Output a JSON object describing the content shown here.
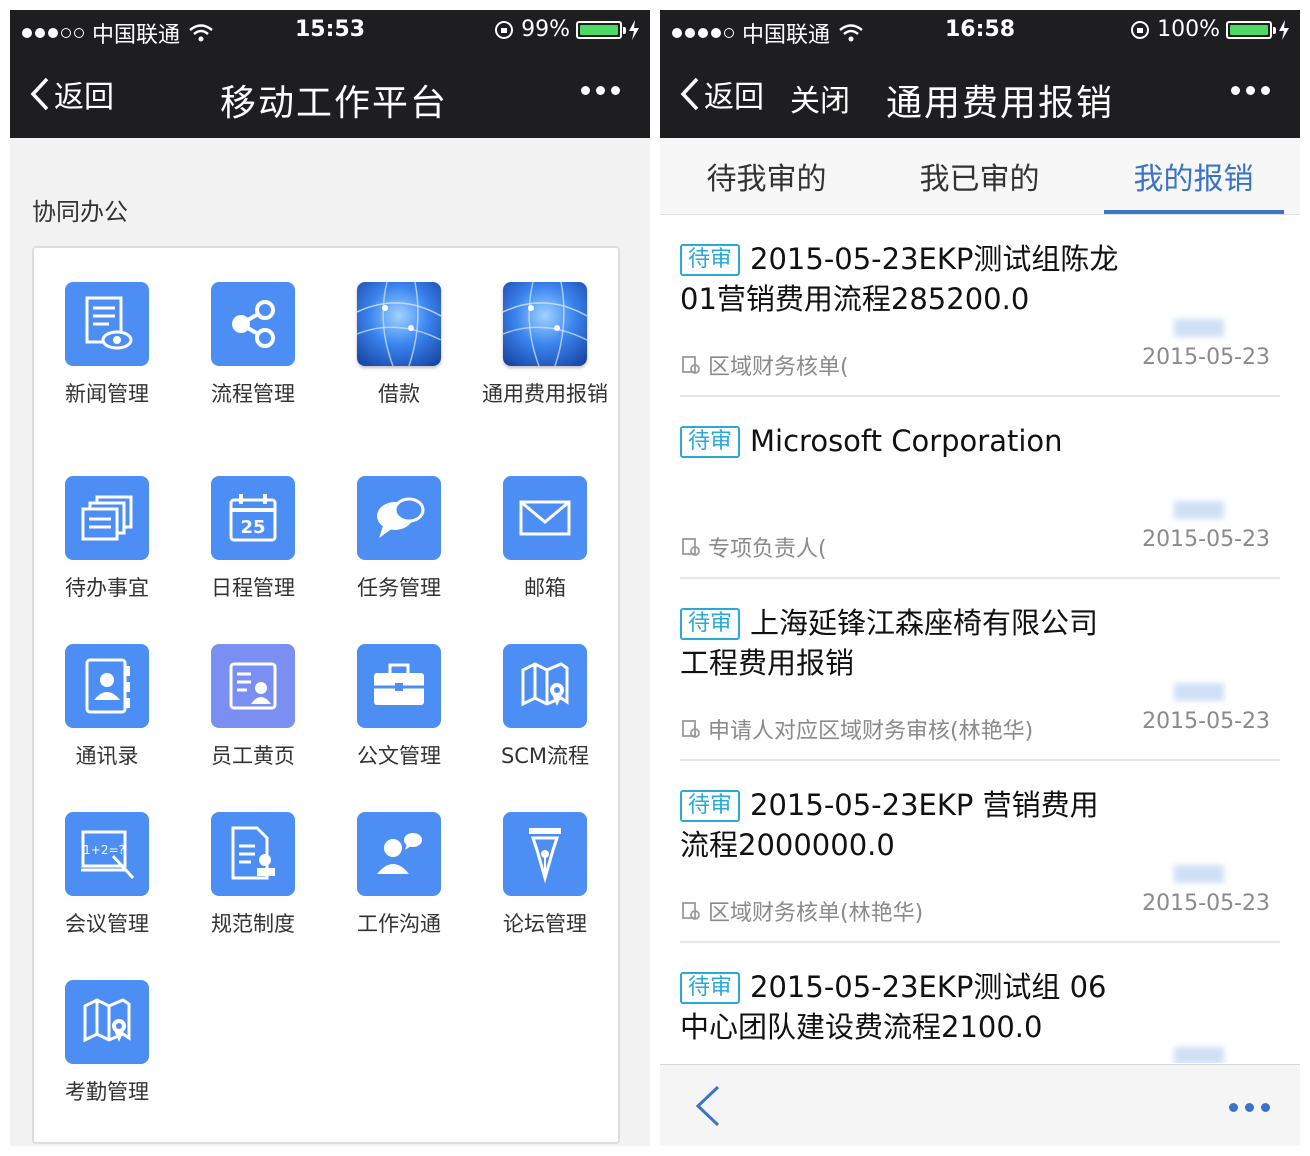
{
  "left": {
    "status": {
      "carrier": "中国联通",
      "time": "15:53",
      "battery": "99%",
      "battery_level": 0.99
    },
    "nav": {
      "back": "返回",
      "title": "移动工作平台"
    },
    "section_title": "协同办公",
    "apps": [
      {
        "label": "新闻管理",
        "icon": "news-icon"
      },
      {
        "label": "流程管理",
        "icon": "share-flow-icon"
      },
      {
        "label": "借款",
        "icon": "globe-icon"
      },
      {
        "label": "通用费用报销",
        "icon": "globe-icon"
      },
      {
        "label": "待办事宜",
        "icon": "todo-list-icon"
      },
      {
        "label": "日程管理",
        "icon": "calendar-icon",
        "icon_text": "25"
      },
      {
        "label": "任务管理",
        "icon": "chat-bubbles-icon"
      },
      {
        "label": "邮箱",
        "icon": "mail-icon"
      },
      {
        "label": "通讯录",
        "icon": "contacts-icon"
      },
      {
        "label": "员工黄页",
        "icon": "directory-icon"
      },
      {
        "label": "公文管理",
        "icon": "briefcase-icon"
      },
      {
        "label": "SCM流程",
        "icon": "map-pin-icon"
      },
      {
        "label": "会议管理",
        "icon": "whiteboard-icon",
        "icon_text": "1+2=?"
      },
      {
        "label": "规范制度",
        "icon": "document-stamp-icon"
      },
      {
        "label": "工作沟通",
        "icon": "person-talk-icon"
      },
      {
        "label": "论坛管理",
        "icon": "pen-nib-icon"
      },
      {
        "label": "考勤管理",
        "icon": "map-pin-icon"
      }
    ]
  },
  "right": {
    "status": {
      "carrier": "中国联通",
      "time": "16:58",
      "battery": "100%",
      "battery_level": 1.0
    },
    "nav": {
      "back": "返回",
      "close": "关闭",
      "title": "通用费用报销"
    },
    "tabs": [
      {
        "label": "待我审的"
      },
      {
        "label": "我已审的"
      },
      {
        "label": "我的报销",
        "active": true
      }
    ],
    "items": [
      {
        "badge": "待审",
        "title": "2015-05-23EKP测试组陈龙01营销费用流程285200.0",
        "sub": "区域财务核单(",
        "date": "2015-05-23"
      },
      {
        "badge": "待审",
        "title": "Microsoft Corporation",
        "sub": "专项负责人(",
        "date": "2015-05-23"
      },
      {
        "badge": "待审",
        "title": "上海延锋江森座椅有限公司工程费用报销",
        "sub": "申请人对应区域财务审核(林艳华)",
        "date": "2015-05-23"
      },
      {
        "badge": "待审",
        "title": "2015-05-23EKP 营销费用流程2000000.0",
        "sub": "区域财务核单(林艳华)",
        "date": "2015-05-23"
      },
      {
        "badge": "待审",
        "title": "2015-05-23EKP测试组 06中心团队建设费流程2100.0",
        "sub": "",
        "date": ""
      }
    ],
    "colors": {
      "accent": "#3a73c9",
      "badge": "#2aa8d6",
      "navbar": "#1e1e20"
    }
  }
}
